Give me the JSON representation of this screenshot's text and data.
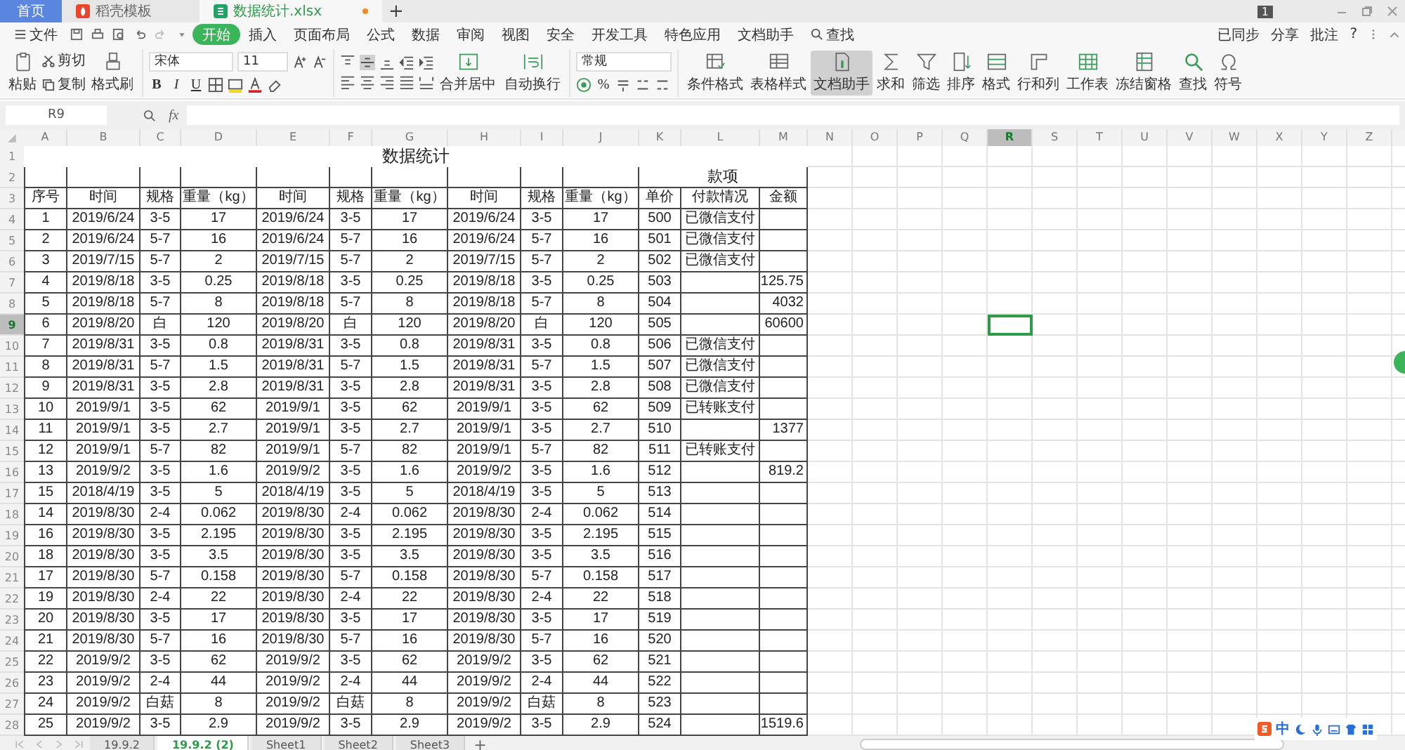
{
  "window": {
    "tabs": [
      {
        "label": "首页",
        "selected": false,
        "kind": "home"
      },
      {
        "label": "稻壳模板",
        "selected": false,
        "kind": "template"
      },
      {
        "label": "数据统计.xlsx",
        "selected": true,
        "kind": "sheet",
        "unsaved": true
      }
    ],
    "new_tab": "+",
    "account_badge": "1"
  },
  "menu": {
    "file": "文件",
    "tabs": [
      {
        "label": "开始",
        "selected": true
      },
      {
        "label": "插入",
        "selected": false
      },
      {
        "label": "页面布局",
        "selected": false
      },
      {
        "label": "公式",
        "selected": false
      },
      {
        "label": "数据",
        "selected": false
      },
      {
        "label": "审阅",
        "selected": false
      },
      {
        "label": "视图",
        "selected": false
      },
      {
        "label": "安全",
        "selected": false
      },
      {
        "label": "开发工具",
        "selected": false
      },
      {
        "label": "特色应用",
        "selected": false
      },
      {
        "label": "文档助手",
        "selected": false
      }
    ],
    "search": "查找",
    "right": [
      "已同步",
      "分享",
      "批注"
    ],
    "help": "?"
  },
  "ribbon": {
    "paste": "粘贴",
    "cut": "剪切",
    "copy": "复制",
    "format_painter": "格式刷",
    "font": "宋体",
    "font_size": "11",
    "bold": "B",
    "italic": "I",
    "underline": "U",
    "merge": "合并居中",
    "wrap": "自动换行",
    "number_format": "常规",
    "percent": "%",
    "tools": [
      {
        "label": "条件格式",
        "kind": "cond",
        "selected": false
      },
      {
        "label": "表格样式",
        "kind": "style",
        "selected": false
      },
      {
        "label": "文档助手",
        "kind": "doc",
        "selected": true
      },
      {
        "label": "求和",
        "kind": "sum",
        "selected": false
      },
      {
        "label": "筛选",
        "kind": "filter",
        "selected": false
      },
      {
        "label": "排序",
        "kind": "sort",
        "selected": false
      },
      {
        "label": "格式",
        "kind": "format",
        "selected": false
      },
      {
        "label": "行和列",
        "kind": "rows",
        "selected": false
      },
      {
        "label": "工作表",
        "kind": "sheet",
        "selected": false
      },
      {
        "label": "冻结窗格",
        "kind": "freeze",
        "selected": false
      },
      {
        "label": "查找",
        "kind": "find",
        "selected": false
      },
      {
        "label": "符号",
        "kind": "symbol",
        "selected": false
      }
    ]
  },
  "formula_bar": {
    "name_box": "R9",
    "fx": "fx"
  },
  "columns": [
    {
      "label": "A",
      "selected": false
    },
    {
      "label": "B",
      "selected": false
    },
    {
      "label": "C",
      "selected": false
    },
    {
      "label": "D",
      "selected": false
    },
    {
      "label": "E",
      "selected": false
    },
    {
      "label": "F",
      "selected": false
    },
    {
      "label": "G",
      "selected": false
    },
    {
      "label": "H",
      "selected": false
    },
    {
      "label": "I",
      "selected": false
    },
    {
      "label": "J",
      "selected": false
    },
    {
      "label": "K",
      "selected": false
    },
    {
      "label": "L",
      "selected": false
    },
    {
      "label": "M",
      "selected": false
    },
    {
      "label": "N",
      "selected": false
    },
    {
      "label": "O",
      "selected": false
    },
    {
      "label": "P",
      "selected": false
    },
    {
      "label": "Q",
      "selected": false
    },
    {
      "label": "R",
      "selected": true
    },
    {
      "label": "S",
      "selected": false
    },
    {
      "label": "T",
      "selected": false
    },
    {
      "label": "U",
      "selected": false
    },
    {
      "label": "V",
      "selected": false
    },
    {
      "label": "W",
      "selected": false
    },
    {
      "label": "X",
      "selected": false
    },
    {
      "label": "Y",
      "selected": false
    },
    {
      "label": "Z",
      "selected": false
    }
  ],
  "sheet": {
    "title": "数据统计",
    "group_header": "款项",
    "headers": [
      "序号",
      "时间",
      "规格",
      "重量（kg）",
      "时间",
      "规格",
      "重量（kg）",
      "时间",
      "规格",
      "重量（kg）",
      "单价",
      "付款情况",
      "金额"
    ],
    "row_numbers": [
      {
        "label": "1",
        "selected": false
      },
      {
        "label": "2",
        "selected": false
      },
      {
        "label": "3",
        "selected": false
      }
    ],
    "rows": [
      {
        "n": "4",
        "selected": false,
        "cells": [
          "1",
          "2019/6/24",
          "3-5",
          "17",
          "2019/6/24",
          "3-5",
          "17",
          "2019/6/24",
          "3-5",
          "17",
          "500",
          "已微信支付",
          null
        ]
      },
      {
        "n": "5",
        "selected": false,
        "cells": [
          "2",
          "2019/6/24",
          "5-7",
          "16",
          "2019/6/24",
          "5-7",
          "16",
          "2019/6/24",
          "5-7",
          "16",
          "501",
          "已微信支付",
          null
        ]
      },
      {
        "n": "6",
        "selected": false,
        "cells": [
          "3",
          "2019/7/15",
          "5-7",
          "2",
          "2019/7/15",
          "5-7",
          "2",
          "2019/7/15",
          "5-7",
          "2",
          "502",
          "已微信支付",
          null
        ]
      },
      {
        "n": "7",
        "selected": false,
        "cells": [
          "4",
          "2019/8/18",
          "3-5",
          "0.25",
          "2019/8/18",
          "3-5",
          "0.25",
          "2019/8/18",
          "3-5",
          "0.25",
          "503",
          null,
          "125.75"
        ]
      },
      {
        "n": "8",
        "selected": false,
        "cells": [
          "5",
          "2019/8/18",
          "5-7",
          "8",
          "2019/8/18",
          "5-7",
          "8",
          "2019/8/18",
          "5-7",
          "8",
          "504",
          null,
          "4032"
        ]
      },
      {
        "n": "9",
        "selected": true,
        "cells": [
          "6",
          "2019/8/20",
          "白",
          "120",
          "2019/8/20",
          "白",
          "120",
          "2019/8/20",
          "白",
          "120",
          "505",
          null,
          "60600"
        ]
      },
      {
        "n": "10",
        "selected": false,
        "cells": [
          "7",
          "2019/8/31",
          "3-5",
          "0.8",
          "2019/8/31",
          "3-5",
          "0.8",
          "2019/8/31",
          "3-5",
          "0.8",
          "506",
          "已微信支付",
          null
        ]
      },
      {
        "n": "11",
        "selected": false,
        "cells": [
          "8",
          "2019/8/31",
          "5-7",
          "1.5",
          "2019/8/31",
          "5-7",
          "1.5",
          "2019/8/31",
          "5-7",
          "1.5",
          "507",
          "已微信支付",
          null
        ]
      },
      {
        "n": "12",
        "selected": false,
        "cells": [
          "9",
          "2019/8/31",
          "3-5",
          "2.8",
          "2019/8/31",
          "3-5",
          "2.8",
          "2019/8/31",
          "3-5",
          "2.8",
          "508",
          "已微信支付",
          null
        ]
      },
      {
        "n": "13",
        "selected": false,
        "cells": [
          "10",
          "2019/9/1",
          "3-5",
          "62",
          "2019/9/1",
          "3-5",
          "62",
          "2019/9/1",
          "3-5",
          "62",
          "509",
          "已转账支付",
          null
        ]
      },
      {
        "n": "14",
        "selected": false,
        "cells": [
          "11",
          "2019/9/1",
          "3-5",
          "2.7",
          "2019/9/1",
          "3-5",
          "2.7",
          "2019/9/1",
          "3-5",
          "2.7",
          "510",
          null,
          "1377"
        ]
      },
      {
        "n": "15",
        "selected": false,
        "cells": [
          "12",
          "2019/9/1",
          "5-7",
          "82",
          "2019/9/1",
          "5-7",
          "82",
          "2019/9/1",
          "5-7",
          "82",
          "511",
          "已转账支付",
          null
        ]
      },
      {
        "n": "16",
        "selected": false,
        "cells": [
          "13",
          "2019/9/2",
          "3-5",
          "1.6",
          "2019/9/2",
          "3-5",
          "1.6",
          "2019/9/2",
          "3-5",
          "1.6",
          "512",
          null,
          "819.2"
        ]
      },
      {
        "n": "17",
        "selected": false,
        "cells": [
          "15",
          "2018/4/19",
          "3-5",
          "5",
          "2018/4/19",
          "3-5",
          "5",
          "2018/4/19",
          "3-5",
          "5",
          "513",
          null,
          null
        ]
      },
      {
        "n": "18",
        "selected": false,
        "cells": [
          "14",
          "2019/8/30",
          "2-4",
          "0.062",
          "2019/8/30",
          "2-4",
          "0.062",
          "2019/8/30",
          "2-4",
          "0.062",
          "514",
          null,
          null
        ]
      },
      {
        "n": "19",
        "selected": false,
        "cells": [
          "16",
          "2019/8/30",
          "3-5",
          "2.195",
          "2019/8/30",
          "3-5",
          "2.195",
          "2019/8/30",
          "3-5",
          "2.195",
          "515",
          null,
          null
        ]
      },
      {
        "n": "20",
        "selected": false,
        "cells": [
          "18",
          "2019/8/30",
          "3-5",
          "3.5",
          "2019/8/30",
          "3-5",
          "3.5",
          "2019/8/30",
          "3-5",
          "3.5",
          "516",
          null,
          null
        ]
      },
      {
        "n": "21",
        "selected": false,
        "cells": [
          "17",
          "2019/8/30",
          "5-7",
          "0.158",
          "2019/8/30",
          "5-7",
          "0.158",
          "2019/8/30",
          "5-7",
          "0.158",
          "517",
          null,
          null
        ]
      },
      {
        "n": "22",
        "selected": false,
        "cells": [
          "19",
          "2019/8/30",
          "2-4",
          "22",
          "2019/8/30",
          "2-4",
          "22",
          "2019/8/30",
          "2-4",
          "22",
          "518",
          null,
          null
        ]
      },
      {
        "n": "23",
        "selected": false,
        "cells": [
          "20",
          "2019/8/30",
          "3-5",
          "17",
          "2019/8/30",
          "3-5",
          "17",
          "2019/8/30",
          "3-5",
          "17",
          "519",
          null,
          null
        ]
      },
      {
        "n": "24",
        "selected": false,
        "cells": [
          "21",
          "2019/8/30",
          "5-7",
          "16",
          "2019/8/30",
          "5-7",
          "16",
          "2019/8/30",
          "5-7",
          "16",
          "520",
          null,
          null
        ]
      },
      {
        "n": "25",
        "selected": false,
        "cells": [
          "22",
          "2019/9/2",
          "3-5",
          "62",
          "2019/9/2",
          "3-5",
          "62",
          "2019/9/2",
          "3-5",
          "62",
          "521",
          null,
          null
        ]
      },
      {
        "n": "26",
        "selected": false,
        "cells": [
          "23",
          "2019/9/2",
          "2-4",
          "44",
          "2019/9/2",
          "2-4",
          "44",
          "2019/9/2",
          "2-4",
          "44",
          "522",
          null,
          null
        ]
      },
      {
        "n": "27",
        "selected": false,
        "cells": [
          "24",
          "2019/9/2",
          "白菇",
          "8",
          "2019/9/2",
          "白菇",
          "8",
          "2019/9/2",
          "白菇",
          "8",
          "523",
          null,
          null
        ]
      },
      {
        "n": "28",
        "selected": false,
        "cells": [
          "25",
          "2019/9/2",
          "3-5",
          "2.9",
          "2019/9/2",
          "3-5",
          "2.9",
          "2019/9/2",
          "3-5",
          "2.9",
          "524",
          null,
          "1519.6"
        ]
      }
    ]
  },
  "sheet_tabs": [
    {
      "label": "19.9.2",
      "selected": false
    },
    {
      "label": "19.9.2 (2)",
      "selected": true
    },
    {
      "label": "Sheet1",
      "selected": false
    },
    {
      "label": "Sheet2",
      "selected": false
    },
    {
      "label": "Sheet3",
      "selected": false
    }
  ],
  "add_sheet": "+",
  "ime": {
    "label": "中"
  }
}
